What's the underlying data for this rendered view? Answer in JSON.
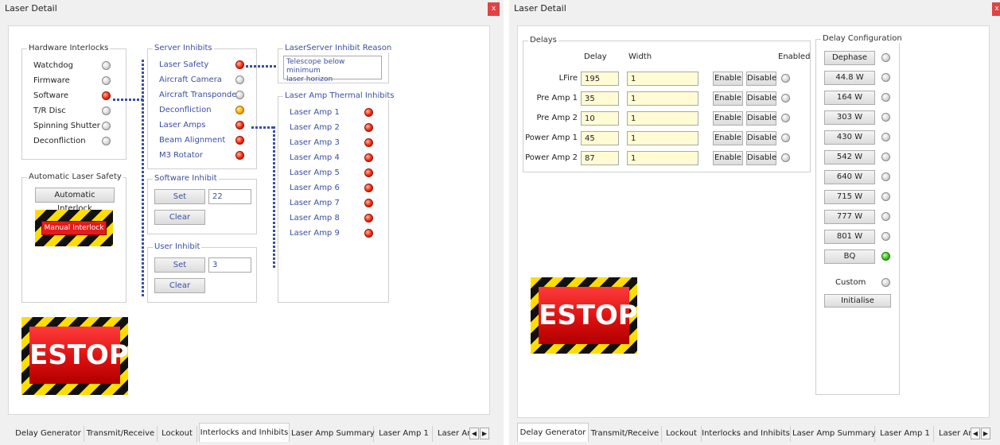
{
  "left": {
    "title": "Laser Detail",
    "close": "x",
    "hardware": {
      "title": "Hardware Interlocks",
      "items": [
        {
          "label": "Watchdog",
          "state": "off"
        },
        {
          "label": "Firmware",
          "state": "off"
        },
        {
          "label": "Software",
          "state": "red"
        },
        {
          "label": "T/R Disc",
          "state": "off"
        },
        {
          "label": "Spinning Shutter",
          "state": "off"
        },
        {
          "label": "Deconfliction",
          "state": "off"
        }
      ]
    },
    "auto_safety": {
      "title": "Automatic Laser Safety",
      "button": "Automatic Interlock",
      "manual": "Manual Interlock"
    },
    "server": {
      "title": "Server Inhibits",
      "items": [
        {
          "label": "Laser Safety",
          "state": "red"
        },
        {
          "label": "Aircraft Camera",
          "state": "off"
        },
        {
          "label": "Aircraft Transponder",
          "state": "off"
        },
        {
          "label": "Deconfliction",
          "state": "orange"
        },
        {
          "label": "Laser Amps",
          "state": "red"
        },
        {
          "label": "Beam Alignment",
          "state": "red"
        },
        {
          "label": "M3 Rotator",
          "state": "red"
        }
      ]
    },
    "software_inhibit": {
      "title": "Software Inhibit",
      "set": "Set",
      "value": "22",
      "clear": "Clear"
    },
    "user_inhibit": {
      "title": "User Inhibit",
      "set": "Set",
      "value": "3",
      "clear": "Clear"
    },
    "reason": {
      "title": "LaserServer Inhibit Reason",
      "text_line1": "Telescope below minimum",
      "text_line2": "laser horizon"
    },
    "thermal": {
      "title": "Laser Amp Thermal Inhibits",
      "items": [
        "Laser Amp 1",
        "Laser Amp 2",
        "Laser Amp 3",
        "Laser Amp 4",
        "Laser Amp 5",
        "Laser Amp 6",
        "Laser Amp 7",
        "Laser Amp 8",
        "Laser Amp 9"
      ],
      "state": "red"
    },
    "estop": "ESTOP",
    "tabs": [
      "Delay Generator",
      "Transmit/Receive",
      "Lockout",
      "Interlocks and Inhibits",
      "Laser Amp Summary",
      "Laser Amp 1",
      "Laser Am"
    ],
    "active_tab": "Interlocks and Inhibits"
  },
  "right": {
    "title": "Laser Detail",
    "close": "x",
    "delays": {
      "title": "Delays",
      "col_delay": "Delay",
      "col_width": "Width",
      "col_enabled": "Enabled",
      "enable": "Enable",
      "disable": "Disable",
      "rows": [
        {
          "label": "LFire",
          "delay": "195",
          "width": "1"
        },
        {
          "label": "Pre Amp 1",
          "delay": "35",
          "width": "1"
        },
        {
          "label": "Pre Amp 2",
          "delay": "10",
          "width": "1"
        },
        {
          "label": "Power Amp 1",
          "delay": "45",
          "width": "1"
        },
        {
          "label": "Power Amp 2",
          "delay": "87",
          "width": "1"
        }
      ]
    },
    "config": {
      "title": "Delay Configuration",
      "items": [
        {
          "label": "Dephase",
          "state": "off"
        },
        {
          "label": "44.8 W",
          "state": "off"
        },
        {
          "label": "164 W",
          "state": "off"
        },
        {
          "label": "303 W",
          "state": "off"
        },
        {
          "label": "430 W",
          "state": "off"
        },
        {
          "label": "542 W",
          "state": "off"
        },
        {
          "label": "640 W",
          "state": "off"
        },
        {
          "label": "715 W",
          "state": "off"
        },
        {
          "label": "777 W",
          "state": "off"
        },
        {
          "label": "801 W",
          "state": "off"
        },
        {
          "label": "BQ",
          "state": "green"
        }
      ],
      "custom": "Custom",
      "initialise": "Initialise"
    },
    "estop": "ESTOP",
    "tabs": [
      "Delay Generator",
      "Transmit/Receive",
      "Lockout",
      "Interlocks and Inhibits",
      "Laser Amp Summary",
      "Laser Amp 1",
      "Laser Am"
    ],
    "active_tab": "Delay Generator"
  }
}
